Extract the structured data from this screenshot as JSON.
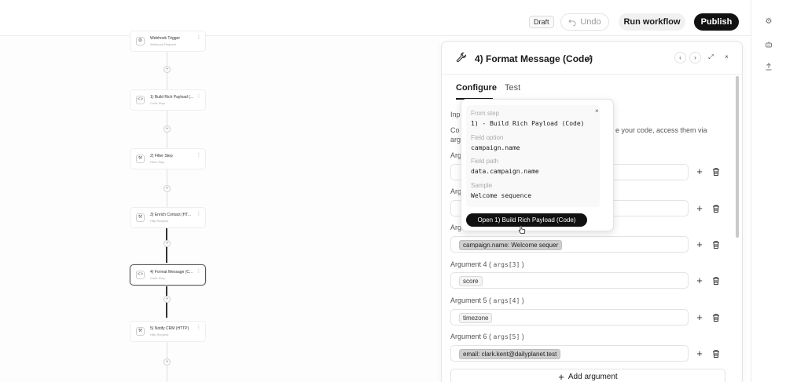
{
  "topbar": {
    "draft": "Draft",
    "undo": "Undo",
    "run": "Run workflow",
    "publish": "Publish"
  },
  "canvas": {
    "nodes": [
      {
        "title": "Webhook Trigger",
        "subtitle": "Webhook Request"
      },
      {
        "title": "1) Build Rich Payload (...",
        "subtitle": "Code Step"
      },
      {
        "title": "2) Filter Step",
        "subtitle": "Filter Step"
      },
      {
        "title": "3) Enrich Contact (HT...",
        "subtitle": "Http Request"
      },
      {
        "title": "4) Format Message (C...",
        "subtitle": "Code Step"
      },
      {
        "title": "5) Notify CRM (HTTP)",
        "subtitle": "Http Request"
      }
    ]
  },
  "panel": {
    "title": "4) Format Message (Code)",
    "tabs": [
      "Configure",
      "Test"
    ],
    "truncated": {
      "inp": "Inp",
      "co": "Co",
      "arg": "arg",
      "desc_right": "e your code, access them via",
      "arg1": "Argu",
      "arg2": "Argu",
      "arg3": "Arg"
    },
    "arguments": [
      {
        "label": "",
        "value": ""
      },
      {
        "label": "",
        "value": ""
      },
      {
        "label": "",
        "value": "campaign.name: Welcome sequer"
      },
      {
        "label": "Argument 4 (",
        "code": "args[3]",
        "close": ")",
        "value": "score"
      },
      {
        "label": "Argument 5 (",
        "code": "args[4]",
        "close": ")",
        "value": "timezone"
      },
      {
        "label": "Argument 6 (",
        "code": "args[5]",
        "close": ")",
        "value": "email: clark.kent@dailyplanet.test"
      }
    ],
    "add_argument": "Add argument"
  },
  "popover": {
    "from_step_label": "From step",
    "from_step_value": "1) - Build Rich Payload (Code)",
    "field_option_label": "Field option",
    "field_option_value": "campaign.name",
    "field_path_label": "Field path",
    "field_path_value": "data.campaign.name",
    "sample_label": "Sample",
    "sample_value": "Welcome sequence",
    "open_button": "Open 1) Build Rich Payload (Code)",
    "close": "×"
  }
}
